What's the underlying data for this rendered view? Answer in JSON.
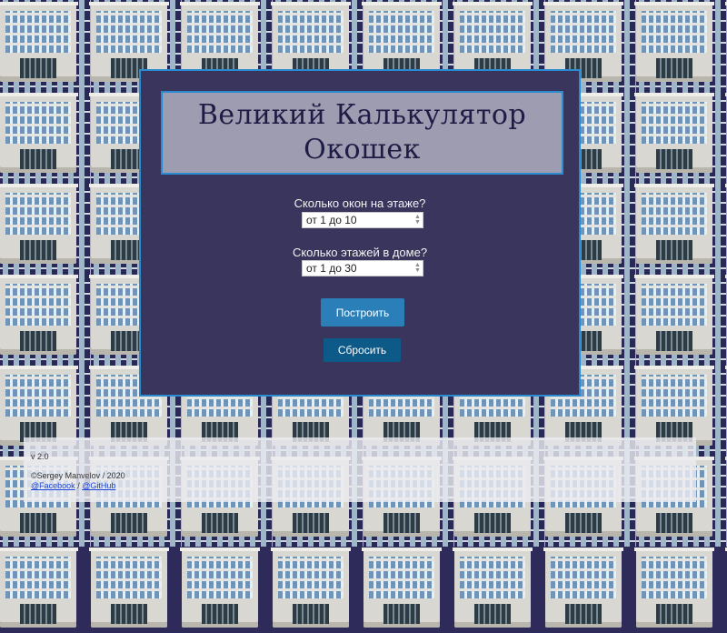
{
  "app": {
    "title": "Великий Калькулятор Окошек"
  },
  "form": {
    "floor_windows_label": "Сколько окон на этаже?",
    "floor_windows_placeholder": "от 1 до 10",
    "floors_label": "Сколько этажей в доме?",
    "floors_placeholder": "от 1 до 30",
    "build_label": "Построить",
    "reset_label": "Сбросить"
  },
  "footer": {
    "version": "v 2.0",
    "copyright": "©Sergey Manvelov / 2020",
    "facebook_label": "@Facebook",
    "separator": "/",
    "github_label": "@GitHub"
  },
  "colors": {
    "panel_bg": "#39355c",
    "panel_border": "#2a8bd1",
    "title_bg": "#9d9cb0",
    "title_text": "#1e1b45",
    "build_button": "#2a7fb8",
    "reset_button": "#0d5a88"
  },
  "background": {
    "pattern_icon": "office-building-icon"
  }
}
